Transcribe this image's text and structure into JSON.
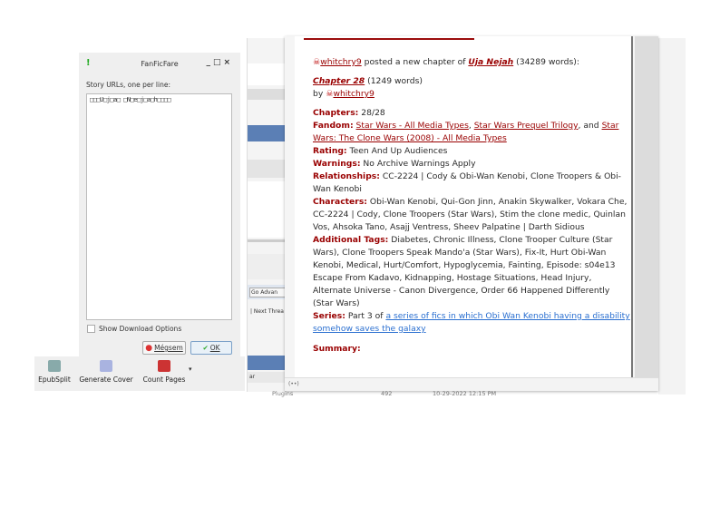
{
  "dialog": {
    "title": "FanFicFare",
    "label": "Story URLs, one per line:",
    "urls_value": "□□□U□j□a□ □N□e□j□a□h□□□□",
    "show_options": "Show Download Options",
    "cancel": "Mégsem",
    "ok": "OK"
  },
  "toolbar": {
    "items": [
      {
        "label": "EpubSplit",
        "icon": "epubsplit-icon"
      },
      {
        "label": "Generate Cover",
        "icon": "generate-cover-icon"
      },
      {
        "label": "Count Pages",
        "icon": "count-pages-icon"
      }
    ]
  },
  "background": {
    "go_advanced": "Go Advan",
    "next_thread": "| Next Threa",
    "col": "ar",
    "plugins_row": {
      "name": "Plugins",
      "count": "492",
      "date": "10-29-2022 12:15 PM"
    }
  },
  "popup": {
    "author": "whitchry9",
    "posted": " posted a new chapter of ",
    "story": "Uja Nejah",
    "story_words": " (34289 words):",
    "chapter": "Chapter 28",
    "chapter_words": " (1249 words)",
    "by": "by ",
    "chapters_label": "Chapters:",
    "chapters": " 28/28",
    "fandom_label": "Fandom:",
    "fandom1": "Star Wars - All Media Types",
    "fandom2": "Star Wars Prequel Trilogy",
    "fandom3": "Star Wars: The Clone Wars (2008) - All Media Types",
    "rating_label": "Rating:",
    "rating": " Teen And Up Audiences",
    "warnings_label": "Warnings:",
    "warnings": " No Archive Warnings Apply",
    "relationships_label": "Relationships:",
    "relationships": " CC-2224 | Cody & Obi-Wan Kenobi, Clone Troopers & Obi-Wan Kenobi",
    "characters_label": "Characters:",
    "characters": " Obi-Wan Kenobi, Qui-Gon Jinn, Anakin Skywalker, Vokara Che, CC-2224 | Cody, Clone Troopers (Star Wars), Stim the clone medic, Quinlan Vos, Ahsoka Tano, Asajj Ventress, Sheev Palpatine | Darth Sidious",
    "tags_label": "Additional Tags:",
    "tags": " Diabetes, Chronic Illness, Clone Trooper Culture (Star Wars), Clone Troopers Speak Mando'a (Star Wars), Fix-It, Hurt Obi-Wan Kenobi, Medical, Hurt/Comfort, Hypoglycemia, Fainting, Episode: s04e13 Escape From Kadavo, Kidnapping, Hostage Situations, Head Injury, Alternate Universe - Canon Divergence, Order 66 Happened Differently (Star Wars)",
    "series_label": "Series:",
    "series_pre": " Part 3 of ",
    "series": "a series of fics in which Obi Wan Kenobi having a disability somehow saves the galaxy",
    "summary_label": "Summary:",
    "status": "(••)"
  }
}
